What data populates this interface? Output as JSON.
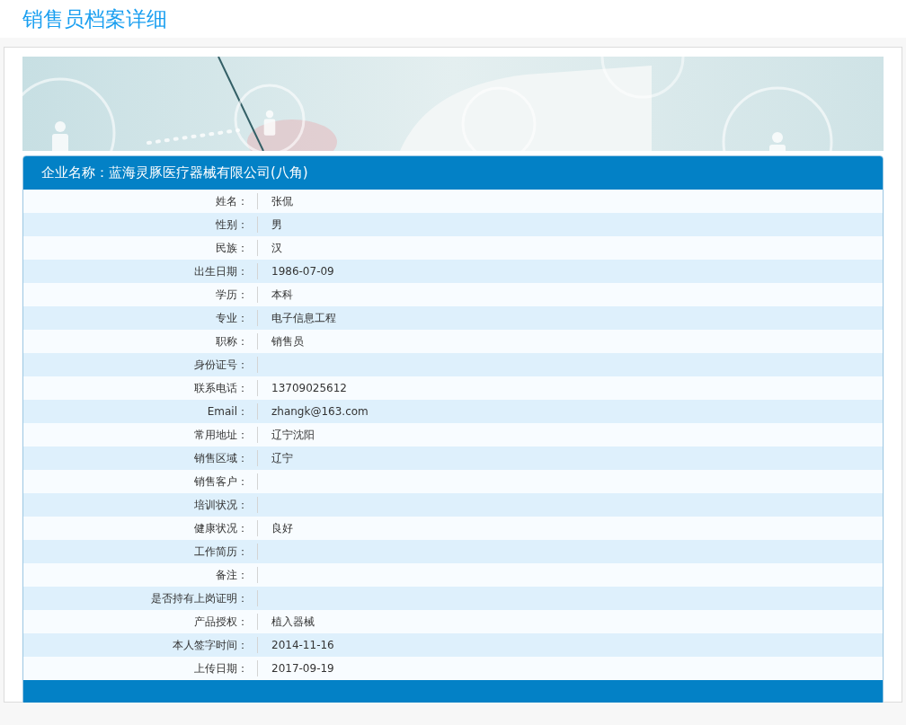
{
  "page_title": "销售员档案详细",
  "card": {
    "header": "企业名称：蓝海灵豚医疗器械有限公司(八角)",
    "rows": [
      {
        "label": "姓名：",
        "value": "张侃"
      },
      {
        "label": "性别：",
        "value": "男"
      },
      {
        "label": "民族：",
        "value": "汉"
      },
      {
        "label": "出生日期：",
        "value": "1986-07-09"
      },
      {
        "label": "学历：",
        "value": "本科"
      },
      {
        "label": "专业：",
        "value": "电子信息工程"
      },
      {
        "label": "职称：",
        "value": "销售员"
      },
      {
        "label": "身份证号："
      },
      {
        "label": "联系电话：",
        "value": "13709025612"
      },
      {
        "label": "Email：",
        "value": "zhangk@163.com"
      },
      {
        "label": "常用地址：",
        "value": "辽宁沈阳"
      },
      {
        "label": "销售区域：",
        "value": "辽宁"
      },
      {
        "label": "销售客户："
      },
      {
        "label": "培训状况："
      },
      {
        "label": "健康状况：",
        "value": "良好"
      },
      {
        "label": "工作简历："
      },
      {
        "label": "备注："
      },
      {
        "label": "是否持有上岗证明："
      },
      {
        "label": "产品授权：",
        "value": "植入器械"
      },
      {
        "label": "本人签字时间：",
        "value": "2014-11-16"
      },
      {
        "label": "上传日期：",
        "value": "2017-09-19"
      }
    ]
  }
}
